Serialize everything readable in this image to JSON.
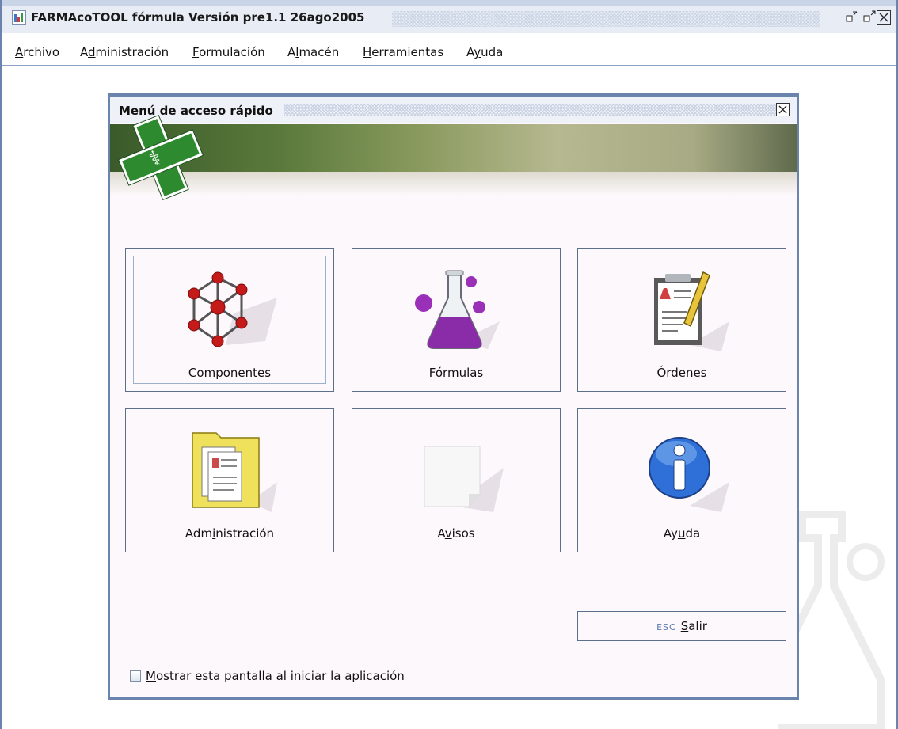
{
  "window": {
    "title": "FARMAcoTOOL fórmula Versión pre1.1 26ago2005",
    "controls": {
      "minimize": "▫↙",
      "maximize": "▫↗",
      "close": "☒"
    }
  },
  "menubar": {
    "items": [
      {
        "pre": "",
        "u": "A",
        "post": "rchivo"
      },
      {
        "pre": "A",
        "u": "d",
        "post": "ministración"
      },
      {
        "pre": "",
        "u": "F",
        "post": "ormulación"
      },
      {
        "pre": "A",
        "u": "l",
        "post": "macén"
      },
      {
        "pre": "",
        "u": "H",
        "post": "erramientas"
      },
      {
        "pre": "A",
        "u": "y",
        "post": "uda"
      }
    ]
  },
  "dialog": {
    "title": "Menú de acceso rápido",
    "close": "☒",
    "tiles": [
      {
        "pre": "",
        "u": "C",
        "post": "omponentes",
        "icon": "molecule-icon"
      },
      {
        "pre": "Fór",
        "u": "m",
        "post": "ulas",
        "icon": "flask-icon"
      },
      {
        "pre": "",
        "u": "Ó",
        "post": "rdenes",
        "icon": "clipboard-icon"
      },
      {
        "pre": "Adm",
        "u": "i",
        "post": "nistración",
        "icon": "folder-icon"
      },
      {
        "pre": "A",
        "u": "v",
        "post": "isos",
        "icon": "note-icon"
      },
      {
        "pre": "Ay",
        "u": "u",
        "post": "da",
        "icon": "info-icon"
      }
    ],
    "exit": {
      "esc": "ESC",
      "u": "S",
      "post": "alir"
    },
    "startup": {
      "u": "M",
      "post": "ostrar esta pantalla al iniciar la aplicación",
      "checked": false
    }
  },
  "colors": {
    "frame": "#6b84ad",
    "banner": "#5a7a3c",
    "cross": "#2e8a2e"
  }
}
